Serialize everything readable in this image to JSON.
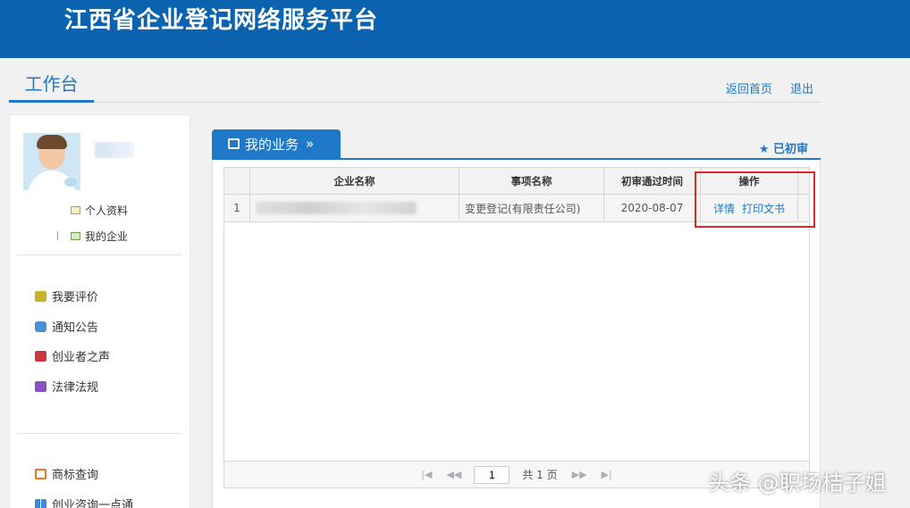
{
  "header": {
    "title": "江西省企业登记网络服务平台"
  },
  "workbar": {
    "title": "工作台",
    "home_link": "返回首页",
    "logout_link": "退出"
  },
  "sidebar": {
    "profile_link": "个人资料",
    "my_company_link": "我的企业",
    "nav_group_1": [
      "我要评价",
      "通知公告",
      "创业者之声",
      "法律法规"
    ],
    "nav_group_2": [
      "商标查询",
      "创业咨询一点通"
    ]
  },
  "main": {
    "tab_label": "我的业务",
    "status_link": "★ 已初审",
    "table": {
      "headers": [
        "企业名称",
        "事项名称",
        "初审通过时间",
        "操作"
      ],
      "rows": [
        {
          "index": "1",
          "company_name": "",
          "item_name": "变更登记(有限责任公司)",
          "date": "2020-08-07",
          "action_detail": "详情",
          "action_print": "打印文书"
        }
      ]
    },
    "pager": {
      "current_page": "1",
      "total_label": "共 1 页"
    }
  },
  "watermark": "头条 @职场桔子姐",
  "colors": {
    "brand_blue": "#0b63b0",
    "accent_blue": "#1f78c8",
    "highlight_red": "#e0262b"
  }
}
